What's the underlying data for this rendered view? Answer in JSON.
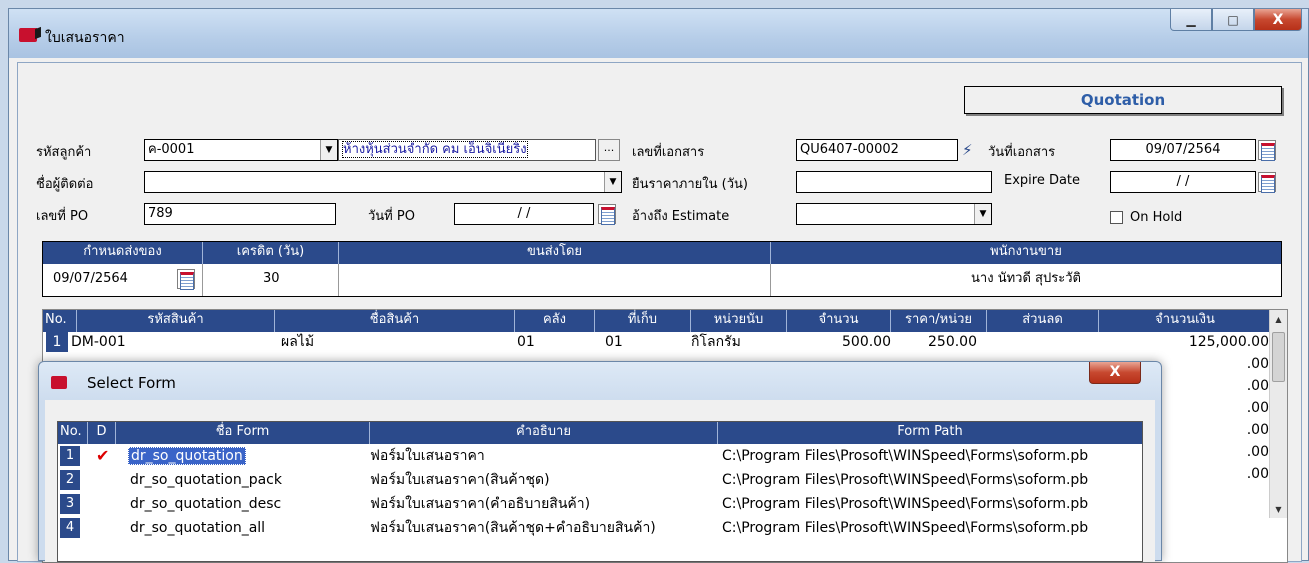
{
  "window": {
    "title": "ใบเสนอราคา",
    "min_glyph": "▁",
    "max_glyph": "□",
    "close_glyph": "X"
  },
  "form": {
    "banner": "Quotation",
    "customer_code_label": "รหัสลูกค้า",
    "customer_code": "ค-0001",
    "customer_name": "ห้างหุ้นส่วนจำกัด คม เอ็นจิเนียริง",
    "browse_label": "...",
    "contact_label": "ชื่อผู้ติดต่อ",
    "contact_value": "",
    "po_no_label": "เลขที่ PO",
    "po_no_value": "789",
    "po_date_label": "วันที่ PO",
    "po_date_value": "/ /",
    "doc_no_label": "เลขที่เอกสาร",
    "doc_no_value": "QU6407-00002",
    "price_valid_label": "ยืนราคาภายใน (วัน)",
    "price_valid_value": "",
    "ref_estimate_label": "อ้างถึง Estimate",
    "ref_estimate_value": "",
    "doc_date_label": "วันที่เอกสาร",
    "doc_date_value": "09/07/2564",
    "expire_label": "Expire Date",
    "expire_value": "/ /",
    "on_hold_label": "On Hold",
    "on_hold_checked": false
  },
  "delivery_grid": {
    "headers": [
      "กำหนดส่งของ",
      "เครดิต (วัน)",
      "ขนส่งโดย",
      "พนักงานขาย"
    ],
    "values": [
      "09/07/2564",
      "30",
      "",
      "นาง นัทวดี สุประวัติ"
    ]
  },
  "items": {
    "headers": [
      "No.",
      "รหัสสินค้า",
      "ชื่อสินค้า",
      "คลัง",
      "ที่เก็บ",
      "หน่วยนับ",
      "จำนวน",
      "ราคา/หน่วย",
      "ส่วนลด",
      "จำนวนเงิน"
    ],
    "rows": [
      {
        "no": "1",
        "code": "DM-001",
        "name": "ผลไม้",
        "wh": "01",
        "loc": "01",
        "unit": "กิโลกรัม",
        "qty": "500.00",
        "price": "250.00",
        "disc": "",
        "amount": "125,000.00"
      }
    ],
    "partial_amounts": [
      ".00",
      ".00",
      ".00",
      ".00",
      ".00",
      ".00"
    ]
  },
  "dialog": {
    "title": "Select Form",
    "close_glyph": "X",
    "headers": [
      "No.",
      "D",
      "ชื่อ Form",
      "คำอธิบาย",
      "Form Path"
    ],
    "rows": [
      {
        "no": "1",
        "d": "✔",
        "name": "dr_so_quotation",
        "desc": "ฟอร์มใบเสนอราคา",
        "path": "C:\\Program Files\\Prosoft\\WINSpeed\\Forms\\soform.pb"
      },
      {
        "no": "2",
        "d": "",
        "name": "dr_so_quotation_pack",
        "desc": "ฟอร์มใบเสนอราคา(สินค้าชุด)",
        "path": "C:\\Program Files\\Prosoft\\WINSpeed\\Forms\\soform.pb"
      },
      {
        "no": "3",
        "d": "",
        "name": "dr_so_quotation_desc",
        "desc": "ฟอร์มใบเสนอราคา(คำอธิบายสินค้า)",
        "path": "C:\\Program Files\\Prosoft\\WINSpeed\\Forms\\soform.pb"
      },
      {
        "no": "4",
        "d": "",
        "name": "dr_so_quotation_all",
        "desc": "ฟอร์มใบเสนอราคา(สินค้าชุด+คำอธิบายสินค้า)",
        "path": "C:\\Program Files\\Prosoft\\WINSpeed\\Forms\\soform.pb"
      }
    ]
  },
  "colors": {
    "header_blue": "#2b4a8b",
    "banner_text": "#2e5ea8",
    "check_red": "#dd0000"
  }
}
